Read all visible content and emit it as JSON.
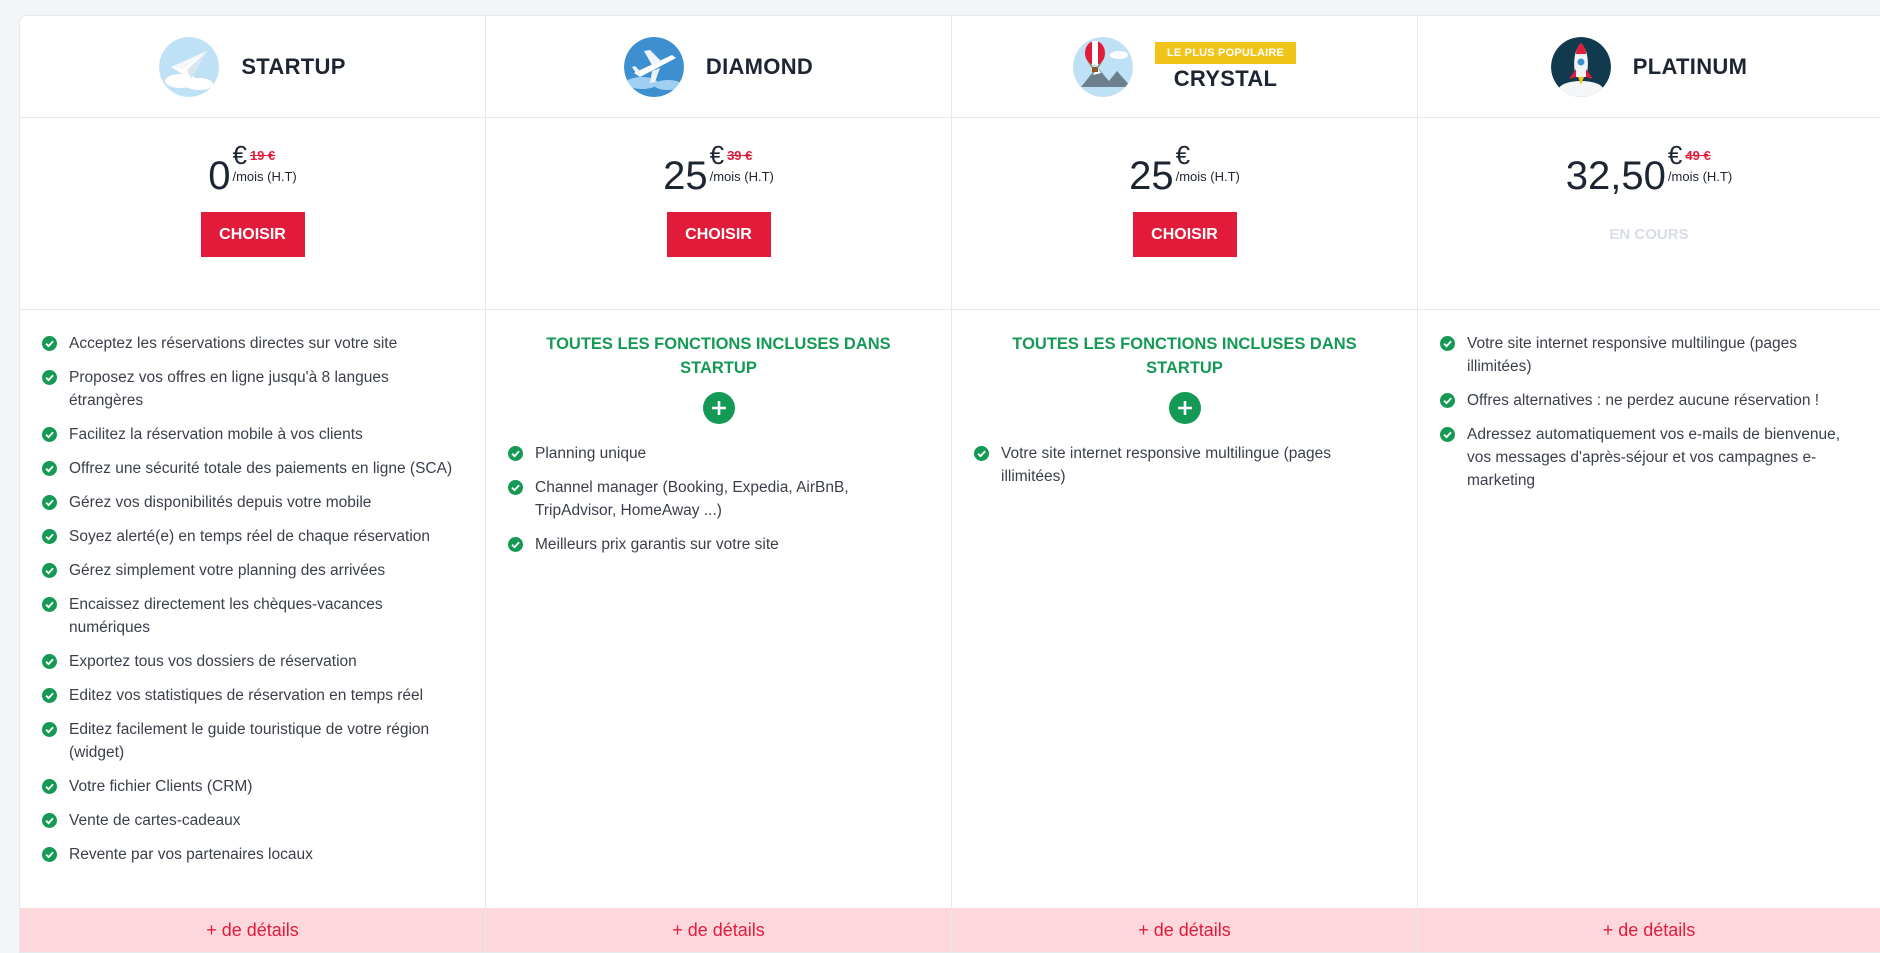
{
  "plans": [
    {
      "name": "STARTUP",
      "icon": "paper-plane-icon",
      "price": "0",
      "currency": "€",
      "old_price": "19 €",
      "period": "/mois (H.T)",
      "action": "CHOISIR",
      "features": [
        "Acceptez les réservations directes sur votre site",
        "Proposez vos offres en ligne jusqu'à 8 langues étrangères",
        "Facilitez la réservation mobile à vos clients",
        "Offrez une sécurité totale des paiements en ligne (SCA)",
        "Gérez vos disponibilités depuis votre mobile",
        "Soyez alerté(e) en temps réel de chaque réservation",
        "Gérez simplement votre planning des arrivées",
        "Encaissez directement les chèques-vacances numériques",
        "Exportez tous vos dossiers de réservation",
        "Editez vos statistiques de réservation en temps réel",
        "Editez facilement le guide touristique de votre région (widget)",
        "Votre fichier Clients (CRM)",
        "Vente de cartes-cadeaux",
        "Revente par vos partenaires locaux"
      ],
      "details": "+ de détails"
    },
    {
      "name": "DIAMOND",
      "icon": "airplane-icon",
      "price": "25",
      "currency": "€",
      "old_price": "39 €",
      "period": "/mois (H.T)",
      "action": "CHOISIR",
      "included": "TOUTES LES FONCTIONS INCLUSES DANS STARTUP",
      "features": [
        "Planning unique",
        "Channel manager (Booking, Expedia, AirBnB, TripAdvisor, HomeAway ...)",
        "Meilleurs prix garantis sur votre site"
      ],
      "details": "+ de détails"
    },
    {
      "name": "CRYSTAL",
      "icon": "hot-air-balloon-icon",
      "badge": "LE PLUS POPULAIRE",
      "price": "25",
      "currency": "€",
      "period": "/mois (H.T)",
      "action": "CHOISIR",
      "included": "TOUTES LES FONCTIONS INCLUSES DANS STARTUP",
      "features": [
        "Votre site internet responsive multilingue (pages illimitées)"
      ],
      "details": "+ de détails"
    },
    {
      "name": "PLATINUM",
      "icon": "rocket-icon",
      "price": "32,50",
      "currency": "€",
      "old_price": "49 €",
      "period": "/mois (H.T)",
      "status": "EN COURS",
      "features": [
        "Votre site internet responsive multilingue (pages illimitées)",
        "Offres alternatives : ne perdez aucune réservation !",
        "Adressez automatiquement vos e-mails de bienvenue, vos messages d'après-séjour et vos campagnes e-marketing"
      ],
      "details": "+ de détails"
    }
  ],
  "colors": {
    "accent_red": "#e31b3a",
    "check_green": "#159a55",
    "badge_yellow": "#f0c419",
    "details_bg": "#fcd7dc"
  }
}
